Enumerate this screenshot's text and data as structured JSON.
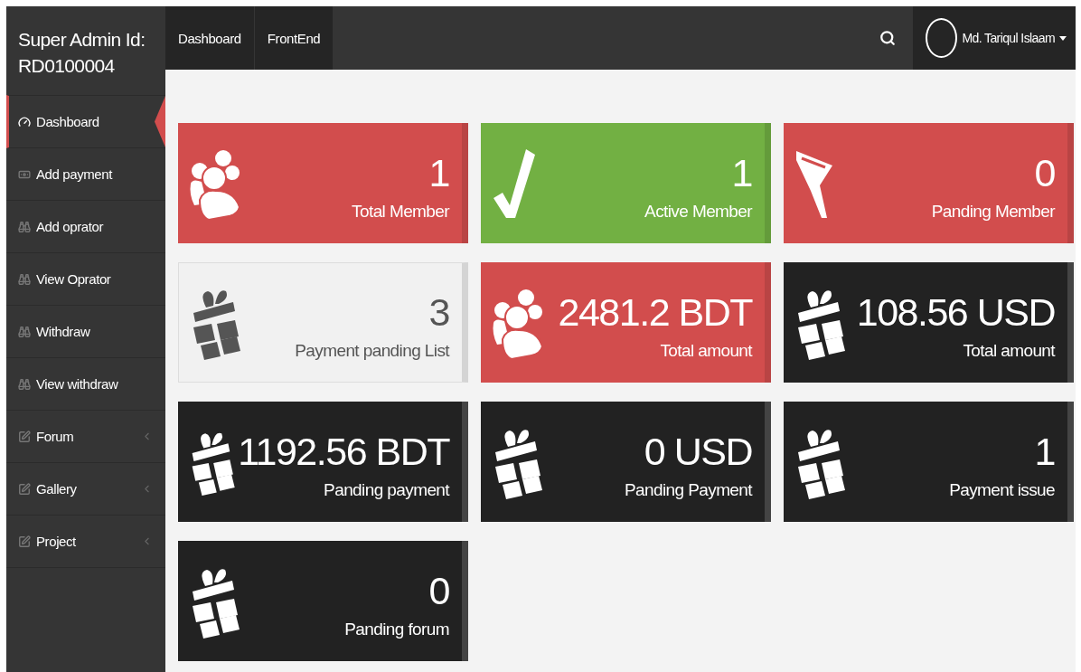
{
  "sidebar": {
    "title": "Super Admin Id: RD0100004",
    "items": [
      {
        "label": "Dashboard",
        "kind": "gauge",
        "selected": true,
        "submenu": false
      },
      {
        "label": "Add payment",
        "kind": "money",
        "selected": false,
        "submenu": false
      },
      {
        "label": "Add oprator",
        "kind": "binoculars",
        "selected": false,
        "submenu": false
      },
      {
        "label": "View Oprator",
        "kind": "binoculars",
        "selected": false,
        "submenu": false
      },
      {
        "label": "Withdraw",
        "kind": "binoculars",
        "selected": false,
        "submenu": false
      },
      {
        "label": "View withdraw",
        "kind": "binoculars",
        "selected": false,
        "submenu": false
      },
      {
        "label": "Forum",
        "kind": "edit",
        "selected": false,
        "submenu": true
      },
      {
        "label": "Gallery",
        "kind": "edit",
        "selected": false,
        "submenu": true
      },
      {
        "label": "Project",
        "kind": "edit",
        "selected": false,
        "submenu": true
      }
    ]
  },
  "topbar": {
    "links": [
      "Dashboard",
      "FrontEnd"
    ],
    "user": "Md. Tariqul Islaam"
  },
  "cards": [
    {
      "value": "1",
      "label": "Total Member",
      "color": "#d24d4d",
      "kind": "users"
    },
    {
      "value": "1",
      "label": "Active Member",
      "color": "#72b043",
      "kind": "check"
    },
    {
      "value": "0",
      "label": "Panding Member",
      "color": "#d24d4d",
      "kind": "filter"
    },
    {
      "value": "3",
      "label": "Payment panding List",
      "color": "#f1f1f1",
      "kind": "gift"
    },
    {
      "value": "2481.2 BDT",
      "label": "Total amount",
      "color": "#d24d4d",
      "kind": "users"
    },
    {
      "value": "108.56 USD",
      "label": "Total amount",
      "color": "#222222",
      "kind": "gift"
    },
    {
      "value": "1192.56 BDT",
      "label": "Panding payment",
      "color": "#222222",
      "kind": "gift"
    },
    {
      "value": "0 USD",
      "label": "Panding Payment",
      "color": "#222222",
      "kind": "gift"
    },
    {
      "value": "1",
      "label": "Payment issue",
      "color": "#222222",
      "kind": "gift"
    },
    {
      "value": "0",
      "label": "Panding forum",
      "color": "#222222",
      "kind": "gift"
    }
  ]
}
